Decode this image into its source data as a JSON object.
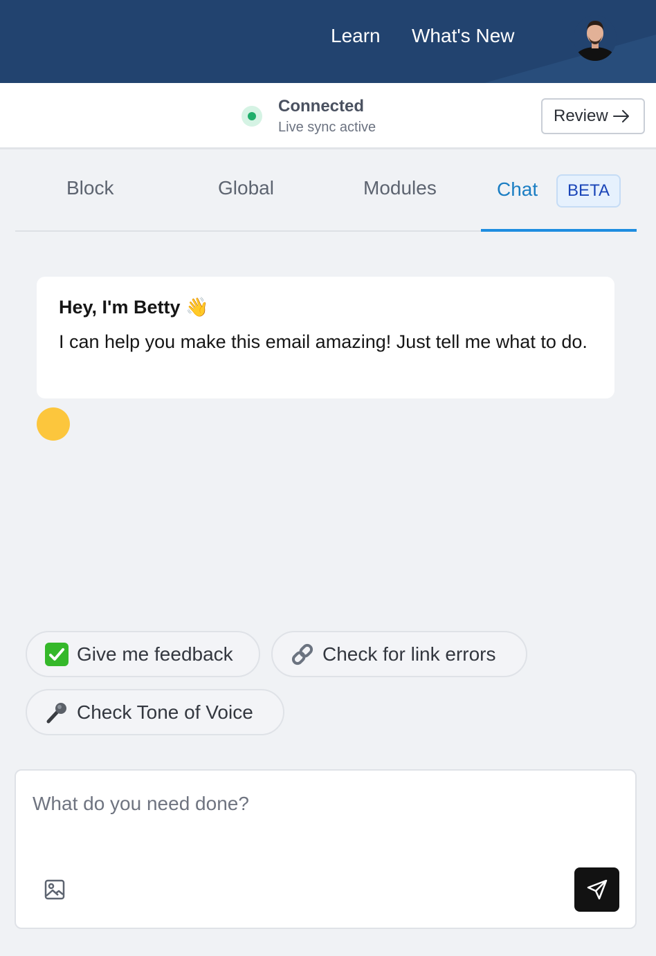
{
  "header": {
    "nav": [
      {
        "label": "Learn"
      },
      {
        "label": "What's New"
      }
    ],
    "avatar_icon": "user-avatar"
  },
  "status": {
    "title": "Connected",
    "subtitle": "Live sync active",
    "review_label": "Review",
    "status_color": "#1fae6b"
  },
  "tabs": [
    {
      "label": "Block"
    },
    {
      "label": "Global"
    },
    {
      "label": "Modules"
    },
    {
      "label": "Chat",
      "active": true,
      "badge": "BETA"
    }
  ],
  "chat": {
    "greeting": "Hey, I'm Betty",
    "greeting_emoji": "👋",
    "message": "I can help you make this email amazing! Just tell me what to do."
  },
  "suggestions": [
    {
      "icon": "✅",
      "label": "Give me feedback"
    },
    {
      "icon": "🔗",
      "label": "Check for link errors"
    },
    {
      "icon": "🎤",
      "label": "Check Tone of Voice"
    }
  ],
  "composer": {
    "placeholder": "What do you need done?",
    "value": ""
  },
  "colors": {
    "header_bg": "#22436f",
    "accent": "#1e8de0",
    "typing_dot": "#fcc63d"
  }
}
